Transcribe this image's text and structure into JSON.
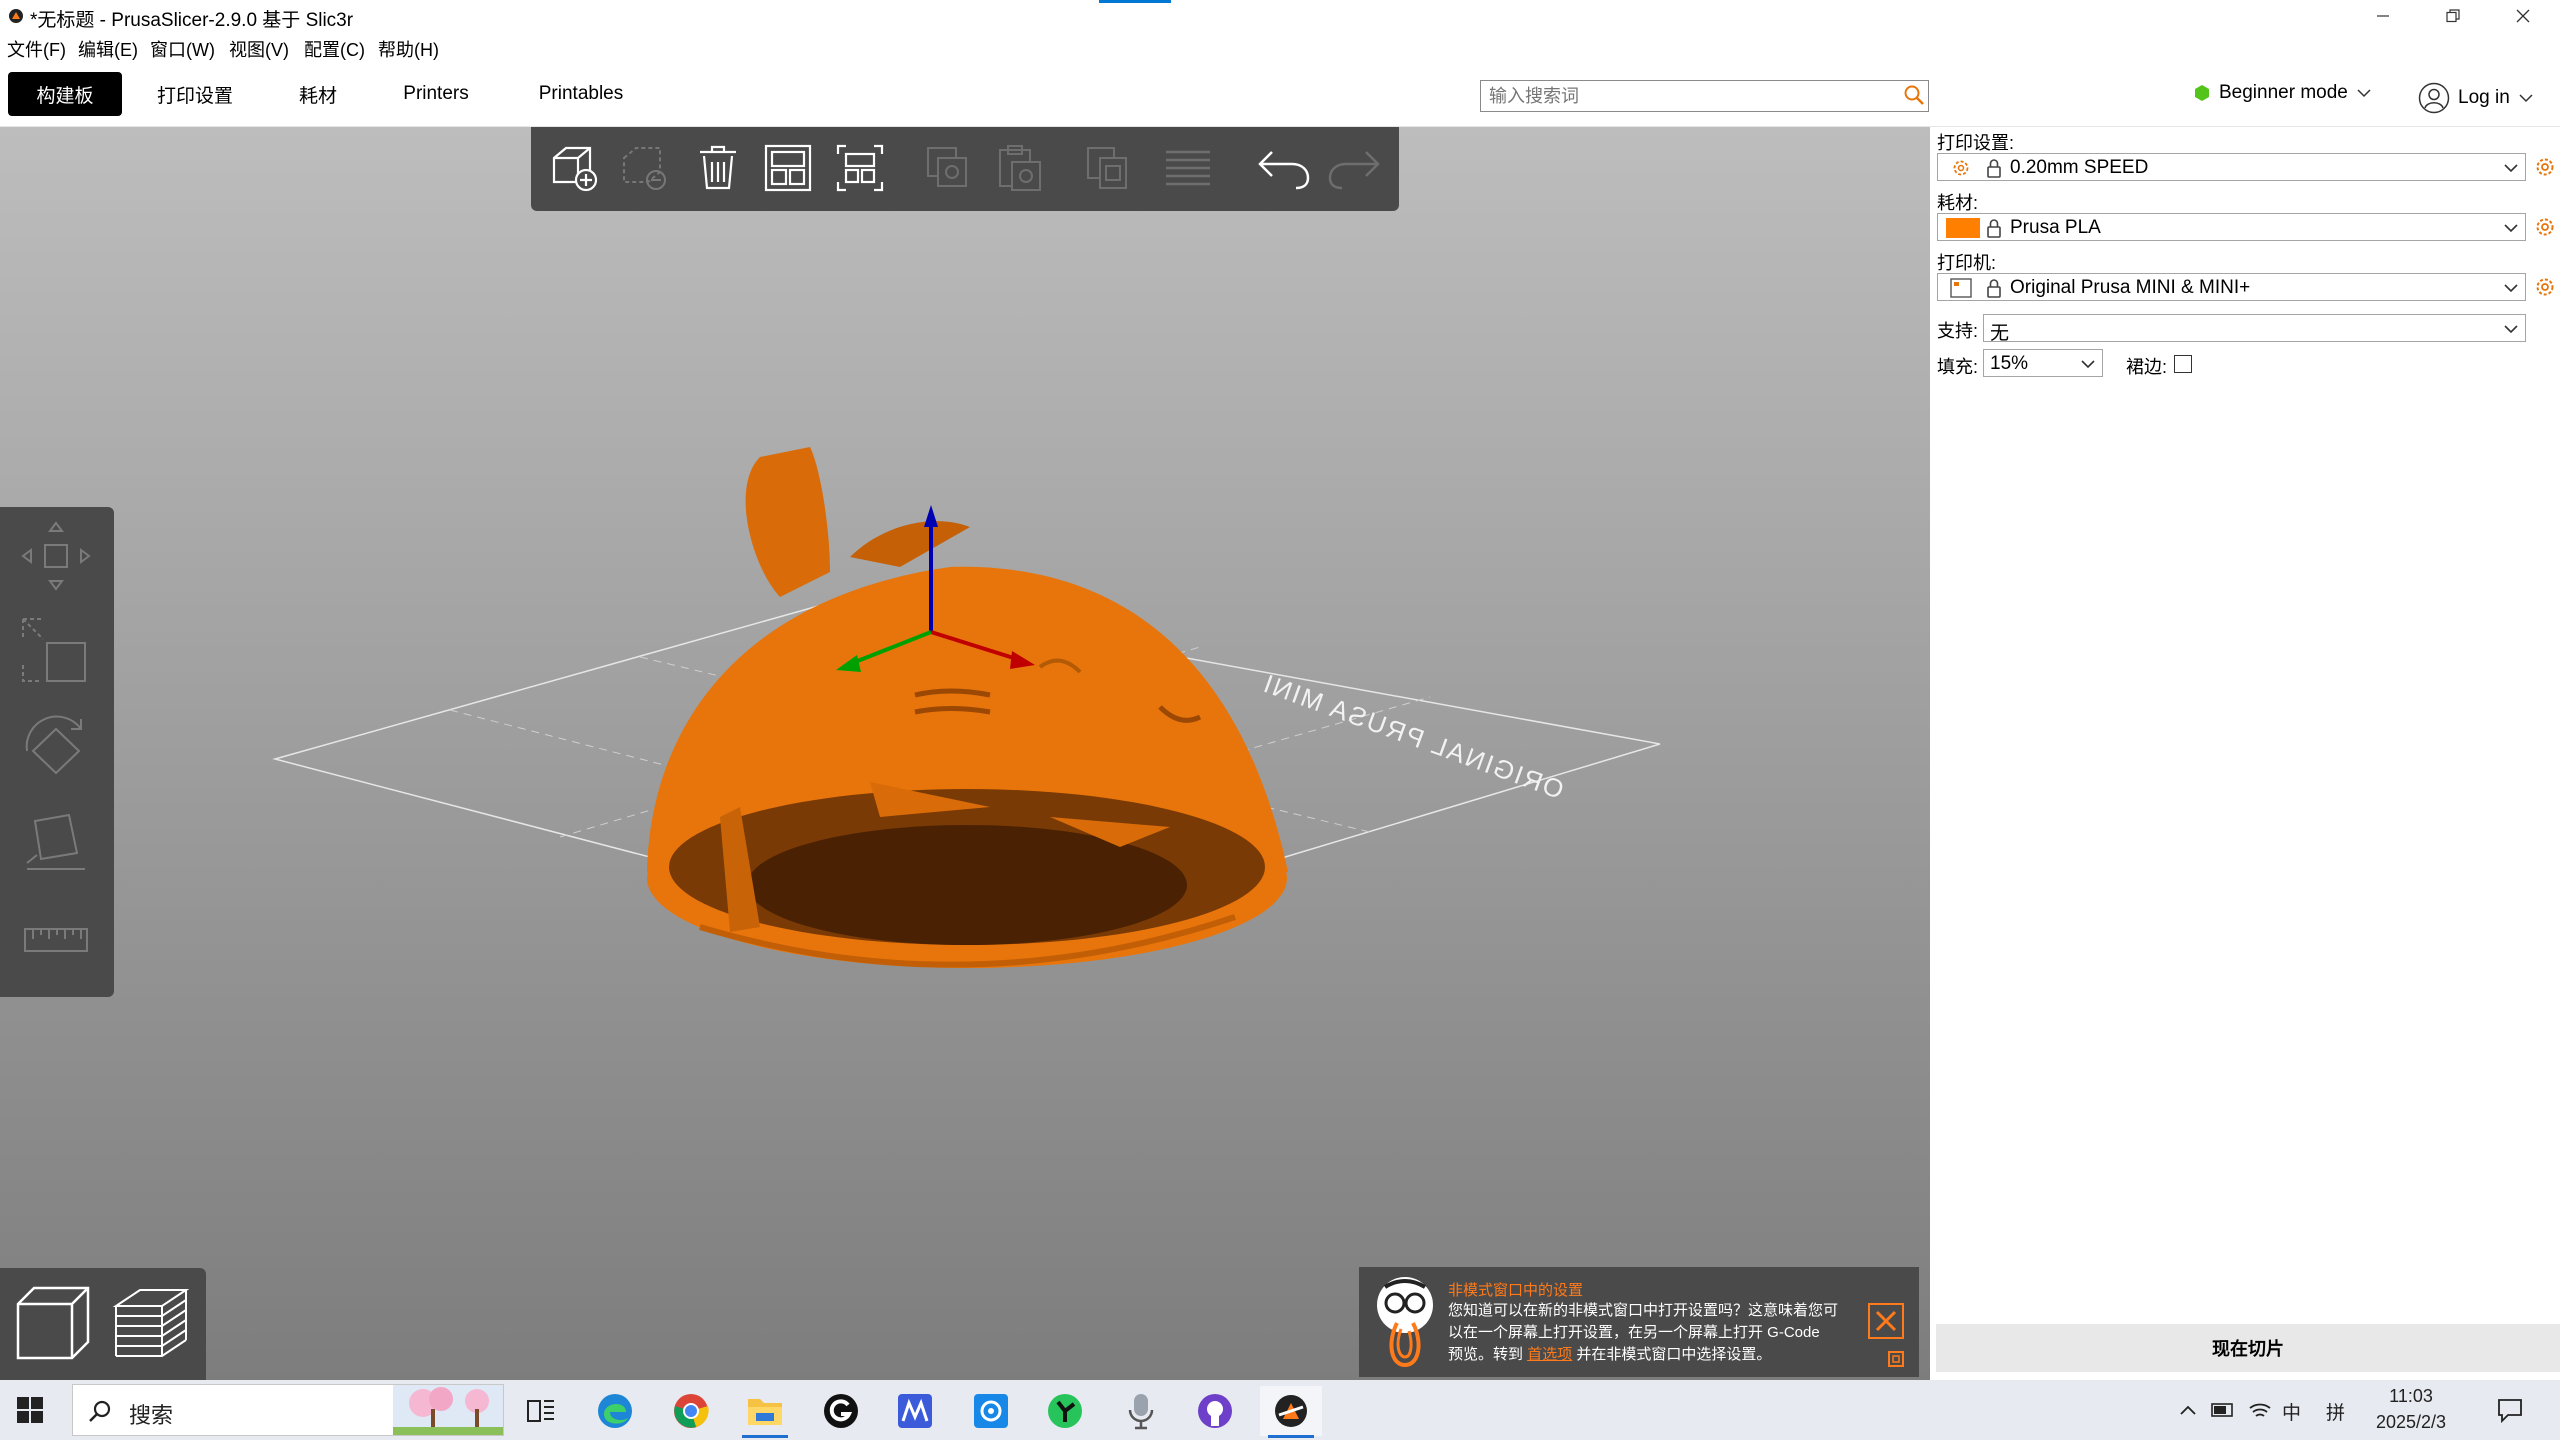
{
  "window": {
    "title": "*无标题 - PrusaSlicer-2.9.0 基于 Slic3r",
    "controls": [
      "minimize",
      "restore",
      "close"
    ]
  },
  "menu": [
    "文件(F)",
    "编辑(E)",
    "窗口(W)",
    "视图(V)",
    "配置(C)",
    "帮助(H)"
  ],
  "tabs": [
    "构建板",
    "打印设置",
    "耗材",
    "Printers",
    "Printables"
  ],
  "active_tab": "构建板",
  "search": {
    "placeholder": "输入搜索词",
    "value": ""
  },
  "mode": {
    "label": "Beginner mode",
    "status_color": "#4caf50"
  },
  "login": {
    "label": "Log in"
  },
  "top_toolbar": [
    {
      "name": "add",
      "enabled": true
    },
    {
      "name": "delete",
      "enabled": false
    },
    {
      "name": "delete-all",
      "enabled": true
    },
    {
      "name": "arrange",
      "enabled": true
    },
    {
      "name": "arrange-selection",
      "enabled": true
    },
    {
      "name": "copy",
      "enabled": false
    },
    {
      "name": "paste",
      "enabled": false
    },
    {
      "name": "add-instance",
      "enabled": false
    },
    {
      "name": "split-to-layers",
      "enabled": false
    },
    {
      "name": "undo",
      "enabled": true
    },
    {
      "name": "redo",
      "enabled": false
    }
  ],
  "left_toolbar": [
    "move-icon",
    "scale-icon",
    "rotate-icon",
    "place-on-face-icon",
    "measure-icon"
  ],
  "viewport": {
    "bed_label": "ORIGINAL PRUSA MINI",
    "model_color": "#e8750b"
  },
  "notification": {
    "title": "非模式窗口中的设置",
    "body_line1": "您知道可以在新的非模式窗口中打开设置吗？这意味着您可",
    "body_line2": "以在一个屏幕上打开设置，在另一个屏幕上打开 G-Code",
    "body_line3_pre": "预览。转到",
    "body_link": "首选项",
    "body_line3_post": "并在非模式窗口中选择设置。"
  },
  "right_panel": {
    "print_settings": {
      "label": "打印设置:",
      "value": "0.20mm SPEED"
    },
    "filament": {
      "label": "耗材:",
      "value": "Prusa PLA",
      "swatch_color": "#ff7f00"
    },
    "printer": {
      "label": "打印机:",
      "value": "Original Prusa MINI & MINI+"
    },
    "support": {
      "label": "支持:",
      "value": "无"
    },
    "infill": {
      "label": "填充:",
      "value": "15%"
    },
    "brim": {
      "label": "裙边:",
      "checked": false
    },
    "slice_button": "现在切片"
  },
  "taskbar": {
    "search_placeholder": "搜索",
    "apps": [
      "task-view",
      "edge",
      "chrome",
      "file-explorer",
      "app-g",
      "app-m",
      "app-blue",
      "app-green",
      "app-mic",
      "github",
      "prusaslicer"
    ],
    "tray": {
      "ime_lang": "中",
      "ime_mode": "拼"
    },
    "time": "11:03",
    "date": "2025/2/3"
  }
}
